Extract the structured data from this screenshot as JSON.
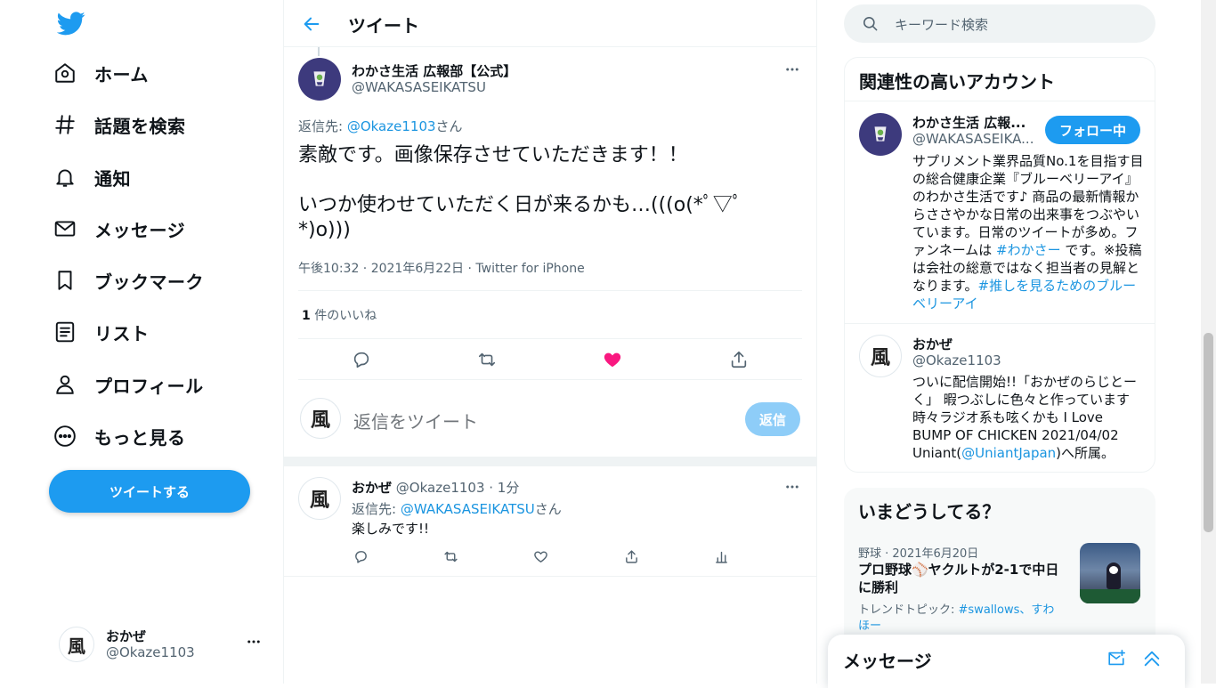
{
  "nav": {
    "items": [
      {
        "icon": "home-icon",
        "label": "ホーム"
      },
      {
        "icon": "hashtag-icon",
        "label": "話題を検索"
      },
      {
        "icon": "bell-icon",
        "label": "通知"
      },
      {
        "icon": "mail-icon",
        "label": "メッセージ"
      },
      {
        "icon": "bookmark-icon",
        "label": "ブックマーク"
      },
      {
        "icon": "list-icon",
        "label": "リスト"
      },
      {
        "icon": "profile-icon",
        "label": "プロフィール"
      },
      {
        "icon": "more-icon",
        "label": "もっと見る"
      }
    ],
    "tweet_button": "ツイートする",
    "account": {
      "name": "おかぜ",
      "handle": "@Okaze1103",
      "avatar_char": "風"
    }
  },
  "header": {
    "title": "ツイート"
  },
  "main_tweet": {
    "author_name": "わかさ生活 広報部【公式】",
    "author_handle": "@WAKASASEIKATSU",
    "reply_prefix": "返信先: ",
    "reply_to": "@Okaze1103",
    "reply_suffix": "さん",
    "text_line1": "素敵です。画像保存させていただきます！！",
    "text_line2": "いつか使わせていただく日が来るかも…(((o(*ﾟ▽ﾟ*)o)))",
    "meta": "午後10:32 · 2021年6月22日 · Twitter for iPhone",
    "like_count": "1",
    "like_label": " 件のいいね",
    "liked": true
  },
  "reply_box": {
    "placeholder": "返信をツイート",
    "button": "返信",
    "avatar_char": "風"
  },
  "reply_tweet": {
    "author_name": "おかぜ",
    "author_handle": "@Okaze1103",
    "time": " · 1分",
    "reply_prefix": "返信先: ",
    "reply_to": "@WAKASASEIKATSU",
    "reply_suffix": "さん",
    "text": "楽しみです!!",
    "avatar_char": "風"
  },
  "search": {
    "placeholder": "キーワード検索"
  },
  "related": {
    "title": "関連性の高いアカウント",
    "accounts": [
      {
        "name": "わかさ生活 広報...",
        "handle": "@WAKASASEIKA...",
        "follow_label": "フォロー中",
        "bio_parts": [
          {
            "t": "サプリメント業界品質No.1を目指す目の総合健康企業『ブルーベリーアイ』のわかさ生活です♪ 商品の最新情報からささやかな日常の出来事をつぶやいています。日常のツイートが多め。ファンネームは ",
            "link": false
          },
          {
            "t": "#わかさー",
            "link": true
          },
          {
            "t": " です。※投稿は会社の総意ではなく担当者の見解となります。",
            "link": false
          },
          {
            "t": "#推しを見るためのブルーベリーアイ",
            "link": true
          }
        ]
      },
      {
        "name": "おかぜ",
        "handle": "@Okaze1103",
        "avatar_char": "風",
        "bio_parts": [
          {
            "t": "ついに配信開始!!「おかぜのらじとーく」 暇つぶしに色々と作っています 時々ラジオ系も呟くかも I Love BUMP OF CHICKEN 2021/04/02 Uniant(",
            "link": false
          },
          {
            "t": "@UniantJapan",
            "link": true
          },
          {
            "t": ")へ所属。",
            "link": false
          }
        ]
      }
    ]
  },
  "trends": {
    "title": "いまどうしてる？",
    "item": {
      "meta": "野球 · 2021年6月20日",
      "title": "プロ野球⚾ヤクルトが2-1で中日に勝利",
      "topic_prefix": "トレンドトピック: ",
      "topic_links": "#swallows、すわほー"
    }
  },
  "messages": {
    "title": "メッセージ"
  },
  "colors": {
    "accent": "#1d9bf0",
    "like": "#f91880",
    "text": "#0f1419",
    "muted": "#536471"
  }
}
